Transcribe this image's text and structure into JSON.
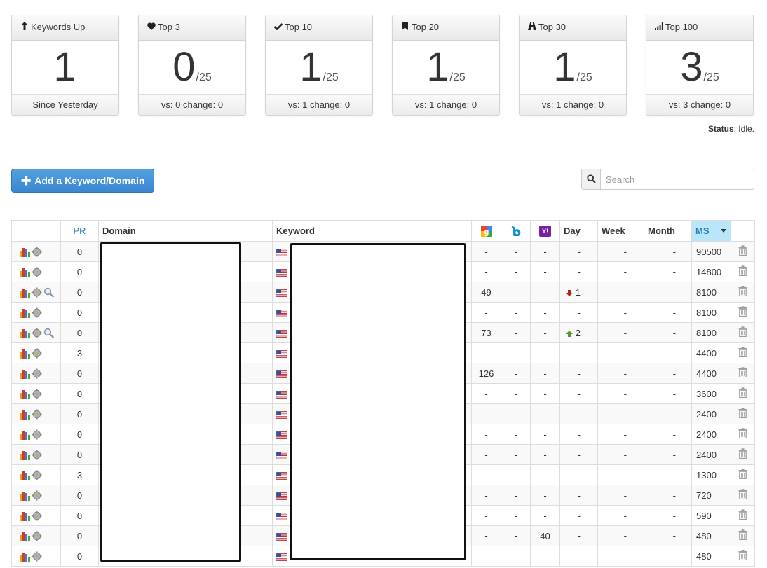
{
  "cards": [
    {
      "icon": "arrow-up-icon",
      "glyph": "🡡",
      "title": "Keywords Up",
      "value": "1",
      "denominator": "",
      "footer": "Since Yesterday"
    },
    {
      "icon": "heart-icon",
      "glyph": "♥",
      "title": "Top 3",
      "value": "0",
      "denominator": "/25",
      "footer": "vs: 0 change: 0"
    },
    {
      "icon": "check-icon",
      "glyph": "✔",
      "title": "Top 10",
      "value": "1",
      "denominator": "/25",
      "footer": "vs: 1 change: 0"
    },
    {
      "icon": "bookmark-icon",
      "glyph": "🔖",
      "title": "Top 20",
      "value": "1",
      "denominator": "/25",
      "footer": "vs: 1 change: 0"
    },
    {
      "icon": "road-icon",
      "glyph": "⛰",
      "title": "Top 30",
      "value": "1",
      "denominator": "/25",
      "footer": "vs: 1 change: 0"
    },
    {
      "icon": "signal-icon",
      "glyph": "▂",
      "title": "Top 100",
      "value": "3",
      "denominator": "/25",
      "footer": "vs: 3 change: 0"
    }
  ],
  "status": {
    "label": "Status",
    "value": ": Idle."
  },
  "toolbar": {
    "add_label": "Add a Keyword/Domain",
    "search_placeholder": "Search"
  },
  "table": {
    "headers": {
      "pr": "PR",
      "domain": "Domain",
      "keyword": "Keyword",
      "day": "Day",
      "week": "Week",
      "month": "Month",
      "ms": "MS"
    },
    "rows": [
      {
        "zoom": false,
        "pr": "0",
        "google": "-",
        "bing": "-",
        "yahoo": "-",
        "day": "-",
        "day_dir": "",
        "week": "-",
        "month": "-",
        "ms": "90500"
      },
      {
        "zoom": false,
        "pr": "0",
        "google": "-",
        "bing": "-",
        "yahoo": "-",
        "day": "-",
        "day_dir": "",
        "week": "-",
        "month": "-",
        "ms": "14800"
      },
      {
        "zoom": true,
        "pr": "0",
        "google": "49",
        "bing": "-",
        "yahoo": "-",
        "day": "1",
        "day_dir": "down",
        "week": "-",
        "month": "-",
        "ms": "8100"
      },
      {
        "zoom": false,
        "pr": "0",
        "google": "-",
        "bing": "-",
        "yahoo": "-",
        "day": "-",
        "day_dir": "",
        "week": "-",
        "month": "-",
        "ms": "8100"
      },
      {
        "zoom": true,
        "pr": "0",
        "google": "73",
        "bing": "-",
        "yahoo": "-",
        "day": "2",
        "day_dir": "up",
        "week": "-",
        "month": "-",
        "ms": "8100"
      },
      {
        "zoom": false,
        "pr": "3",
        "google": "-",
        "bing": "-",
        "yahoo": "-",
        "day": "-",
        "day_dir": "",
        "week": "-",
        "month": "-",
        "ms": "4400"
      },
      {
        "zoom": false,
        "pr": "0",
        "google": "126",
        "bing": "-",
        "yahoo": "-",
        "day": "-",
        "day_dir": "",
        "week": "-",
        "month": "-",
        "ms": "4400"
      },
      {
        "zoom": false,
        "pr": "0",
        "google": "-",
        "bing": "-",
        "yahoo": "-",
        "day": "-",
        "day_dir": "",
        "week": "-",
        "month": "-",
        "ms": "3600"
      },
      {
        "zoom": false,
        "pr": "0",
        "google": "-",
        "bing": "-",
        "yahoo": "-",
        "day": "-",
        "day_dir": "",
        "week": "-",
        "month": "-",
        "ms": "2400"
      },
      {
        "zoom": false,
        "pr": "0",
        "google": "-",
        "bing": "-",
        "yahoo": "-",
        "day": "-",
        "day_dir": "",
        "week": "-",
        "month": "-",
        "ms": "2400"
      },
      {
        "zoom": false,
        "pr": "0",
        "google": "-",
        "bing": "-",
        "yahoo": "-",
        "day": "-",
        "day_dir": "",
        "week": "-",
        "month": "-",
        "ms": "2400"
      },
      {
        "zoom": false,
        "pr": "3",
        "google": "-",
        "bing": "-",
        "yahoo": "-",
        "day": "-",
        "day_dir": "",
        "week": "-",
        "month": "-",
        "ms": "1300"
      },
      {
        "zoom": false,
        "pr": "0",
        "google": "-",
        "bing": "-",
        "yahoo": "-",
        "day": "-",
        "day_dir": "",
        "week": "-",
        "month": "-",
        "ms": "720"
      },
      {
        "zoom": false,
        "pr": "0",
        "google": "-",
        "bing": "-",
        "yahoo": "-",
        "day": "-",
        "day_dir": "",
        "week": "-",
        "month": "-",
        "ms": "590"
      },
      {
        "zoom": false,
        "pr": "0",
        "google": "-",
        "bing": "-",
        "yahoo": "40",
        "day": "-",
        "day_dir": "",
        "week": "-",
        "month": "-",
        "ms": "480"
      },
      {
        "zoom": false,
        "pr": "0",
        "google": "-",
        "bing": "-",
        "yahoo": "-",
        "day": "-",
        "day_dir": "",
        "week": "-",
        "month": "-",
        "ms": "480"
      }
    ]
  },
  "colors": {
    "accent": "#3a87d0",
    "ms_header": "#b9e6f9",
    "pr_header": "#2a7ab8",
    "arrow_up": "#4f9a2e",
    "arrow_down": "#c0201a"
  }
}
